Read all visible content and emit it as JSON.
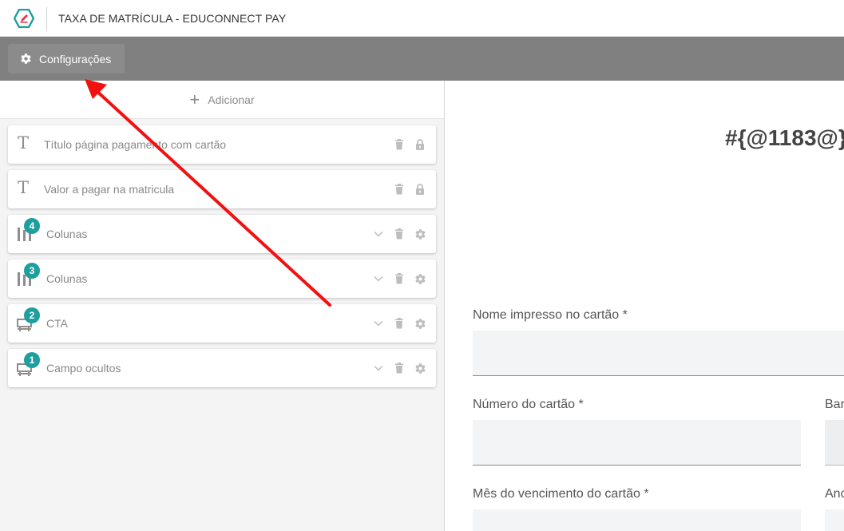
{
  "header": {
    "title": "TAXA DE MATRÍCULA - EDUCONNECT PAY",
    "logo_icon": "edit-pencil-hexagon-icon",
    "accent_color": "#1f9e9e",
    "logo_color": "#e53950"
  },
  "toolbar": {
    "settings_label": "Configurações",
    "settings_icon": "gear-icon"
  },
  "editor": {
    "add_label": "Adicionar",
    "blocks": [
      {
        "label": "Título página pagamento com cartão",
        "icon": "text-icon",
        "controls": [
          "trash-icon",
          "lock-icon"
        ]
      },
      {
        "label": "Valor a pagar na matricula",
        "icon": "text-icon",
        "controls": [
          "trash-icon",
          "lock-icon"
        ]
      },
      {
        "label": "Colunas",
        "icon": "columns-icon",
        "badge": "4",
        "controls": [
          "chevron-down-icon",
          "trash-icon",
          "gear-icon"
        ]
      },
      {
        "label": "Colunas",
        "icon": "columns-icon",
        "badge": "3",
        "controls": [
          "chevron-down-icon",
          "trash-icon",
          "gear-icon"
        ]
      },
      {
        "label": "CTA",
        "icon": "form-icon",
        "badge": "2",
        "controls": [
          "chevron-down-icon",
          "trash-icon",
          "gear-icon"
        ]
      },
      {
        "label": "Campo ocultos",
        "icon": "form-icon",
        "badge": "1",
        "controls": [
          "chevron-down-icon",
          "trash-icon",
          "gear-icon"
        ]
      }
    ]
  },
  "preview": {
    "title": "#{@1183@}",
    "fields": {
      "card_name": {
        "label": "Nome impresso no cartão *",
        "value": ""
      },
      "card_number": {
        "label": "Número do cartão *",
        "value": ""
      },
      "flag": {
        "label": "Bar",
        "value": ""
      },
      "exp_month": {
        "label": "Mês do vencimento do cartão *",
        "value": ""
      },
      "exp_year": {
        "label": "Anc",
        "value": ""
      }
    }
  },
  "annotation": {
    "arrow_color": "#f21010"
  }
}
